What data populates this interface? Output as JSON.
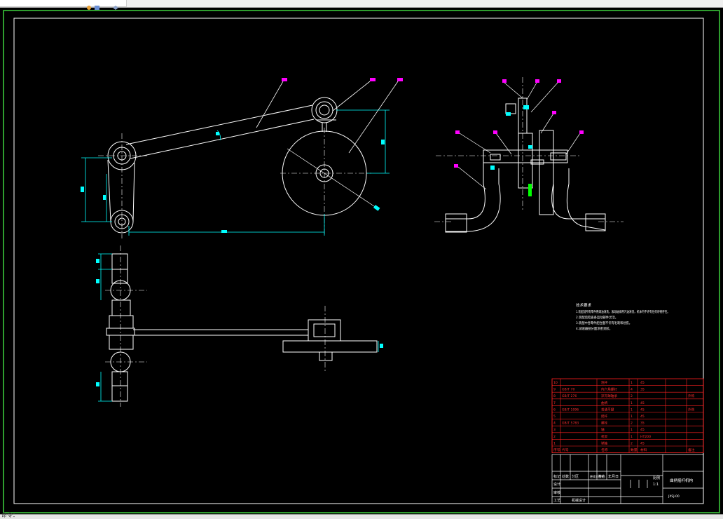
{
  "app": {
    "tab_icons": [
      "toolbar-icon-a",
      "toolbar-icon-b",
      "toolbar-icon-c"
    ],
    "status_text": "命令："
  },
  "colors": {
    "background": "#000000",
    "line": "#ffffff",
    "dimension": "#00ffff",
    "leader": "#ff00ff",
    "table": "#ff0000",
    "frame": "#2e9d2e",
    "hatch": "#00ff00"
  },
  "drawing": {
    "notes": {
      "title": "技术要求",
      "lines": [
        "1.装配前所有零件用煤油清洗，滚动轴承用汽油清洗，机体内不许有任何杂物存在。",
        "2.装配后检查各运动部件灵活。",
        "3.装配中各零件配合面不许有毛刺和划伤。",
        "4.减速器剖分面涂密封胶。"
      ]
    },
    "parts_rows": [
      {
        "no": "10",
        "code": "",
        "name": "连杆",
        "qty": "1",
        "material": "45",
        "note": ""
      },
      {
        "no": "9",
        "code": "GB/T 70",
        "name": "内六角螺钉",
        "qty": "4",
        "material": "35",
        "note": ""
      },
      {
        "no": "8",
        "code": "GB/T 276",
        "name": "深沟球轴承",
        "qty": "2",
        "material": "",
        "note": "外购"
      },
      {
        "no": "7",
        "code": "",
        "name": "曲柄",
        "qty": "1",
        "material": "45",
        "note": ""
      },
      {
        "no": "6",
        "code": "GB/T 1096",
        "name": "普通平键",
        "qty": "1",
        "material": "45",
        "note": "外购"
      },
      {
        "no": "5",
        "code": "",
        "name": "摇杆",
        "qty": "1",
        "material": "45",
        "note": ""
      },
      {
        "no": "4",
        "code": "GB/T 5783",
        "name": "螺栓",
        "qty": "2",
        "material": "35",
        "note": ""
      },
      {
        "no": "3",
        "code": "",
        "name": "轴",
        "qty": "1",
        "material": "45",
        "note": ""
      },
      {
        "no": "2",
        "code": "",
        "name": "机架",
        "qty": "1",
        "material": "HT200",
        "note": ""
      },
      {
        "no": "1",
        "code": "",
        "name": "销轴",
        "qty": "2",
        "material": "45",
        "note": ""
      }
    ],
    "parts_header": {
      "no": "序号",
      "code": "代号",
      "name": "名称",
      "qty": "数量",
      "material": "材料",
      "note": "备注"
    },
    "title_block": {
      "drawing_title": "曲柄摇杆机构",
      "drawing_number": "JXSJ-00",
      "row_labels": [
        "标记",
        "设计",
        "审核",
        "工艺"
      ],
      "col_labels": [
        "处数",
        "分区",
        "更改文件号",
        "签名",
        "年月日"
      ],
      "scale_label": "比例",
      "scale_value": "1:1",
      "school": "机械设计"
    }
  }
}
